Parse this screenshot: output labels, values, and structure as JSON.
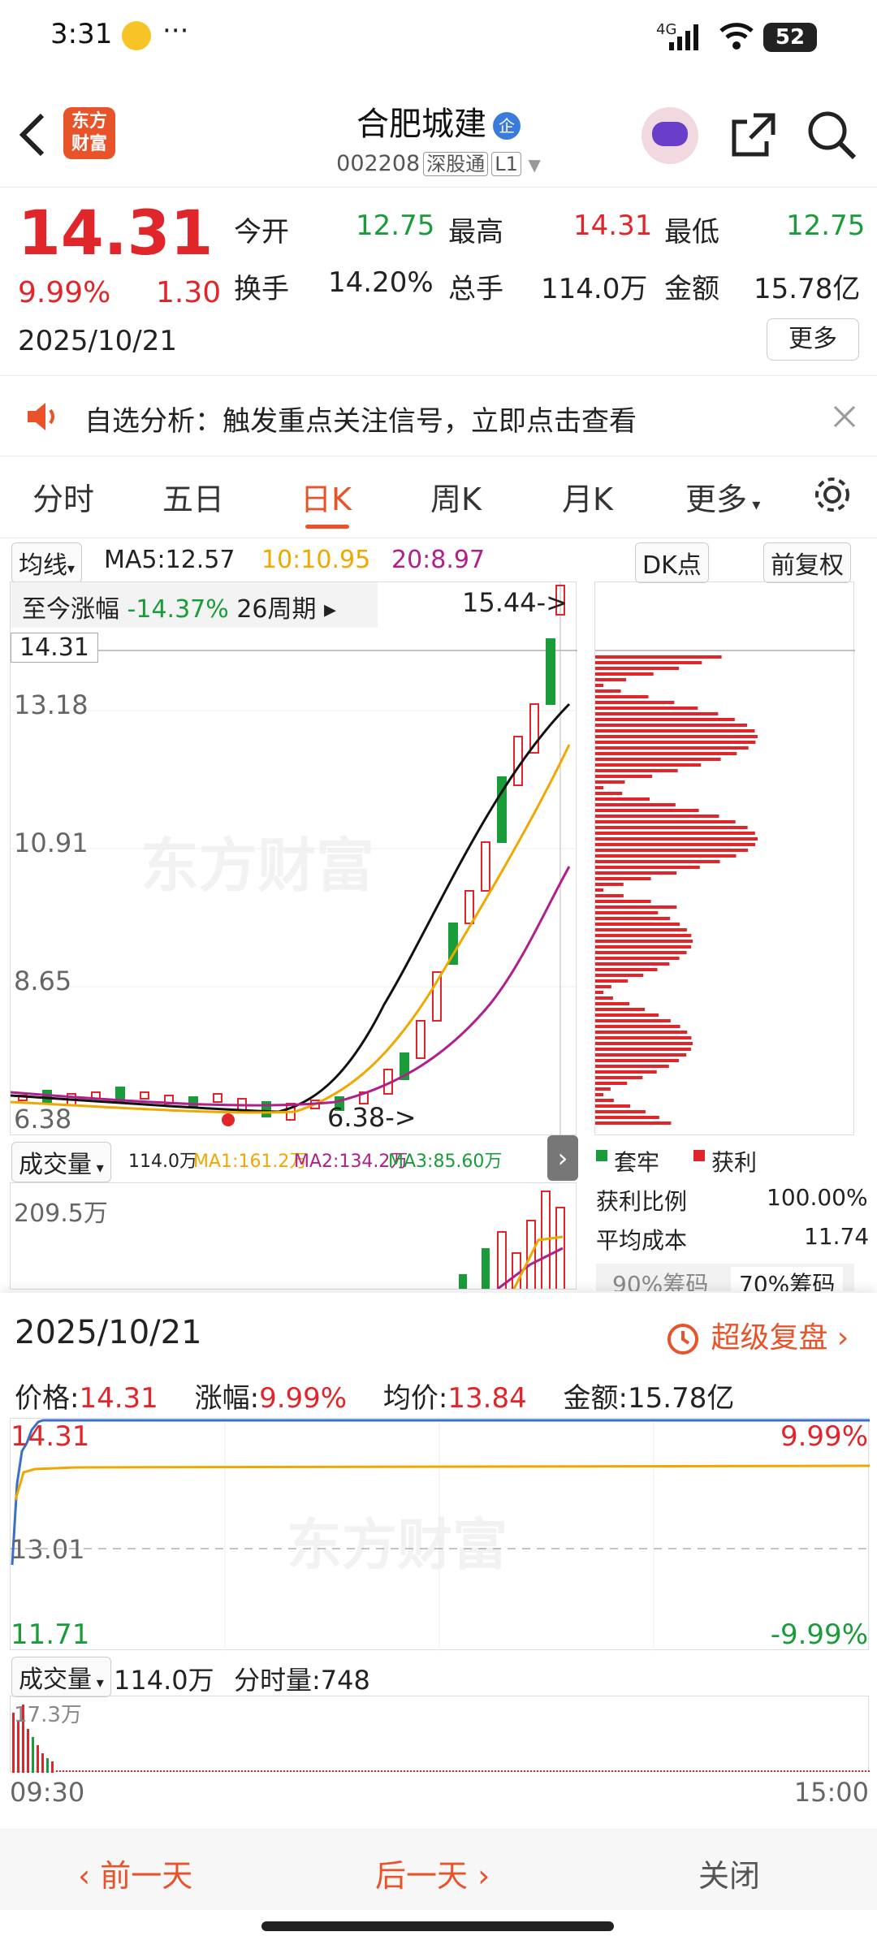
{
  "status": {
    "time": "3:31",
    "network": "4G",
    "battery": "52",
    "dots": "···"
  },
  "header": {
    "title": "合肥城建",
    "badge": "企",
    "code": "002208",
    "tag1": "深股通",
    "tag2": "L1",
    "logo_line1": "东方",
    "logo_line2": "财富"
  },
  "quote": {
    "price": "14.31",
    "pct": "9.99%",
    "chg": "1.30",
    "date": "2025/10/21",
    "open_label": "今开",
    "open": "12.75",
    "high_label": "最高",
    "high": "14.31",
    "low_label": "最低",
    "low": "12.75",
    "turnover_label": "换手",
    "turnover": "14.20%",
    "vol_label": "总手",
    "vol": "114.0万",
    "amount_label": "金额",
    "amount": "15.78亿",
    "more": "更多"
  },
  "notice": {
    "text": "自选分析：触发重点关注信号，立即点击查看"
  },
  "tabs": [
    "分时",
    "五日",
    "日K",
    "周K",
    "月K",
    "更多"
  ],
  "kline": {
    "ma_select": "均线",
    "ma5": "MA5:12.57",
    "ma10": "10:10.95",
    "ma20": "20:8.97",
    "dk": "DK点",
    "adjust": "前复权",
    "range_label": "至今涨幅",
    "range_value": "-14.37%",
    "period": "26周期",
    "high_mark": "15.44->",
    "low_mark": "6.38->",
    "cur_price": "14.31",
    "y_labels": [
      "13.18",
      "10.91",
      "8.65",
      "6.38"
    ],
    "watermark": "东方财富",
    "vol_select": "成交量",
    "vol_val": "114.0万",
    "ma1": "MA1:161.2万",
    "ma2": "MA2:134.2万",
    "ma3": "MA3:85.60万",
    "vol_y": "209.5万",
    "legend_a": "套牢",
    "legend_b": "获利",
    "profit_label": "获利比例",
    "profit": "100.00%",
    "cost_label": "平均成本",
    "cost": "11.74",
    "chip90": "90%筹码",
    "chip70": "70%筹码"
  },
  "panel": {
    "date": "2025/10/21",
    "replay": "超级复盘",
    "price_label": "价格:",
    "price": "14.31",
    "pct_label": "涨幅:",
    "pct": "9.99%",
    "avg_label": "均价:",
    "avg": "13.84",
    "amt_label": "金额:",
    "amt": "15.78亿",
    "top_price": "14.31",
    "top_pct": "9.99%",
    "mid_price": "13.01",
    "bot_price": "11.71",
    "bot_pct": "-9.99%",
    "vol_select": "成交量",
    "vol": "114.0万",
    "min_vol": "分时量:748",
    "vol_y": "17.3万",
    "t_start": "09:30",
    "t_end": "15:00",
    "watermark": "东方财富"
  },
  "footer": {
    "prev": "前一天",
    "next": "后一天",
    "close": "关闭"
  },
  "colors": {
    "up": "#e0262b",
    "down": "#1a9c3a",
    "brand": "#e8532a",
    "ma10": "#f0a800",
    "ma20": "#b0208a"
  }
}
